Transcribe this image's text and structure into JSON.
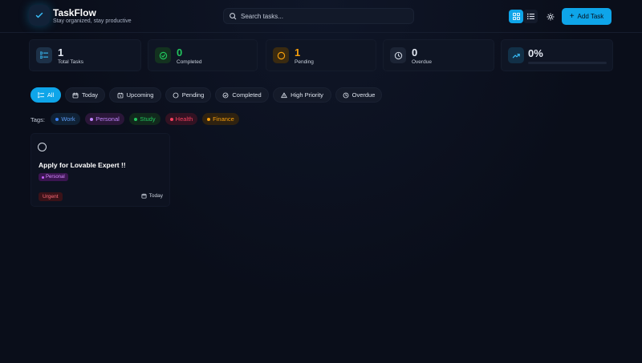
{
  "app": {
    "title": "TaskFlow",
    "subtitle": "Stay organized, stay productive"
  },
  "search": {
    "placeholder": "Search tasks..."
  },
  "header": {
    "add_task_label": "Add Task"
  },
  "stats": [
    {
      "value": "1",
      "label": "Total Tasks",
      "icon": "list-icon",
      "color": "#e6ebf5"
    },
    {
      "value": "0",
      "label": "Completed",
      "icon": "check-circle-icon",
      "color": "#22c55e"
    },
    {
      "value": "1",
      "label": "Pending",
      "icon": "circle-icon",
      "color": "#f59e0b"
    },
    {
      "value": "0",
      "label": "Overdue",
      "icon": "clock-icon",
      "color": "#e6ebf5"
    }
  ],
  "progress": {
    "value": "0%",
    "fraction": 0
  },
  "filters": [
    {
      "label": "All",
      "icon": "list-icon",
      "active": true
    },
    {
      "label": "Today",
      "icon": "calendar-icon"
    },
    {
      "label": "Upcoming",
      "icon": "calendar-clock-icon"
    },
    {
      "label": "Pending",
      "icon": "circle-icon"
    },
    {
      "label": "Completed",
      "icon": "check-circle-icon"
    },
    {
      "label": "High Priority",
      "icon": "alert-triangle-icon"
    },
    {
      "label": "Overdue",
      "icon": "clock-icon"
    }
  ],
  "tags_label": "Tags:",
  "tags": [
    {
      "label": "Work",
      "color": "#3b82f6"
    },
    {
      "label": "Personal",
      "color": "#c084fc"
    },
    {
      "label": "Study",
      "color": "#22c55e"
    },
    {
      "label": "Health",
      "color": "#f43f5e"
    },
    {
      "label": "Finance",
      "color": "#f59e0b"
    }
  ],
  "tasks": [
    {
      "title": "Apply for Lovable Expert !!",
      "tag": "Personal",
      "priority": "Urgent",
      "due": "Today"
    }
  ],
  "colors": {
    "accent": "#0ea5e9",
    "background": "#0a0e1a"
  }
}
